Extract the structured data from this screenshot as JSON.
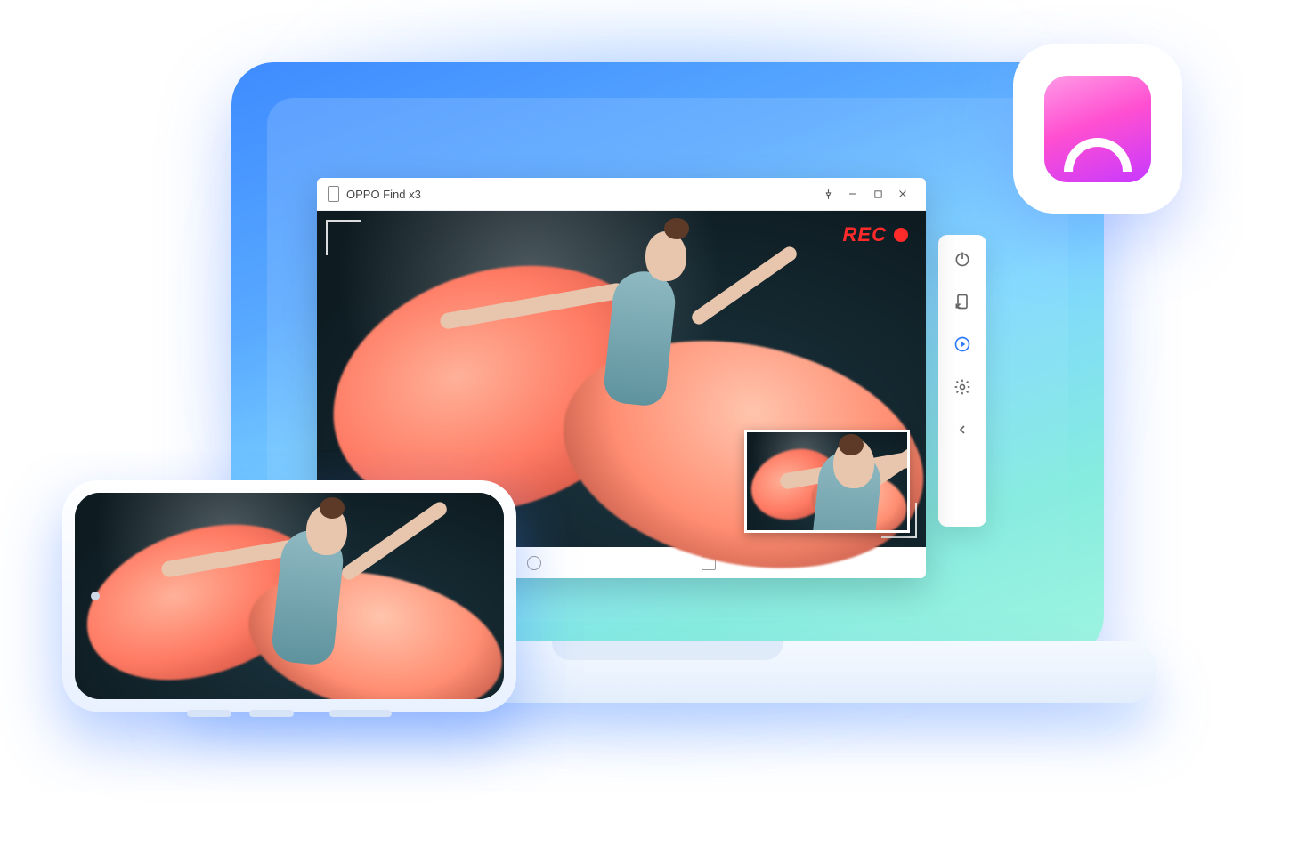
{
  "window": {
    "device_title": "OPPO Find x3",
    "rec_label": "REC"
  },
  "toolbar": {
    "items": [
      {
        "name": "power",
        "active": false
      },
      {
        "name": "screenshot",
        "active": false
      },
      {
        "name": "record",
        "active": true
      },
      {
        "name": "settings",
        "active": false
      },
      {
        "name": "collapse",
        "active": false
      }
    ]
  },
  "nav": {
    "back": "‹",
    "home": "○",
    "recent": "□"
  },
  "colors": {
    "accent": "#2f7bff",
    "rec": "#ff2a2a"
  }
}
